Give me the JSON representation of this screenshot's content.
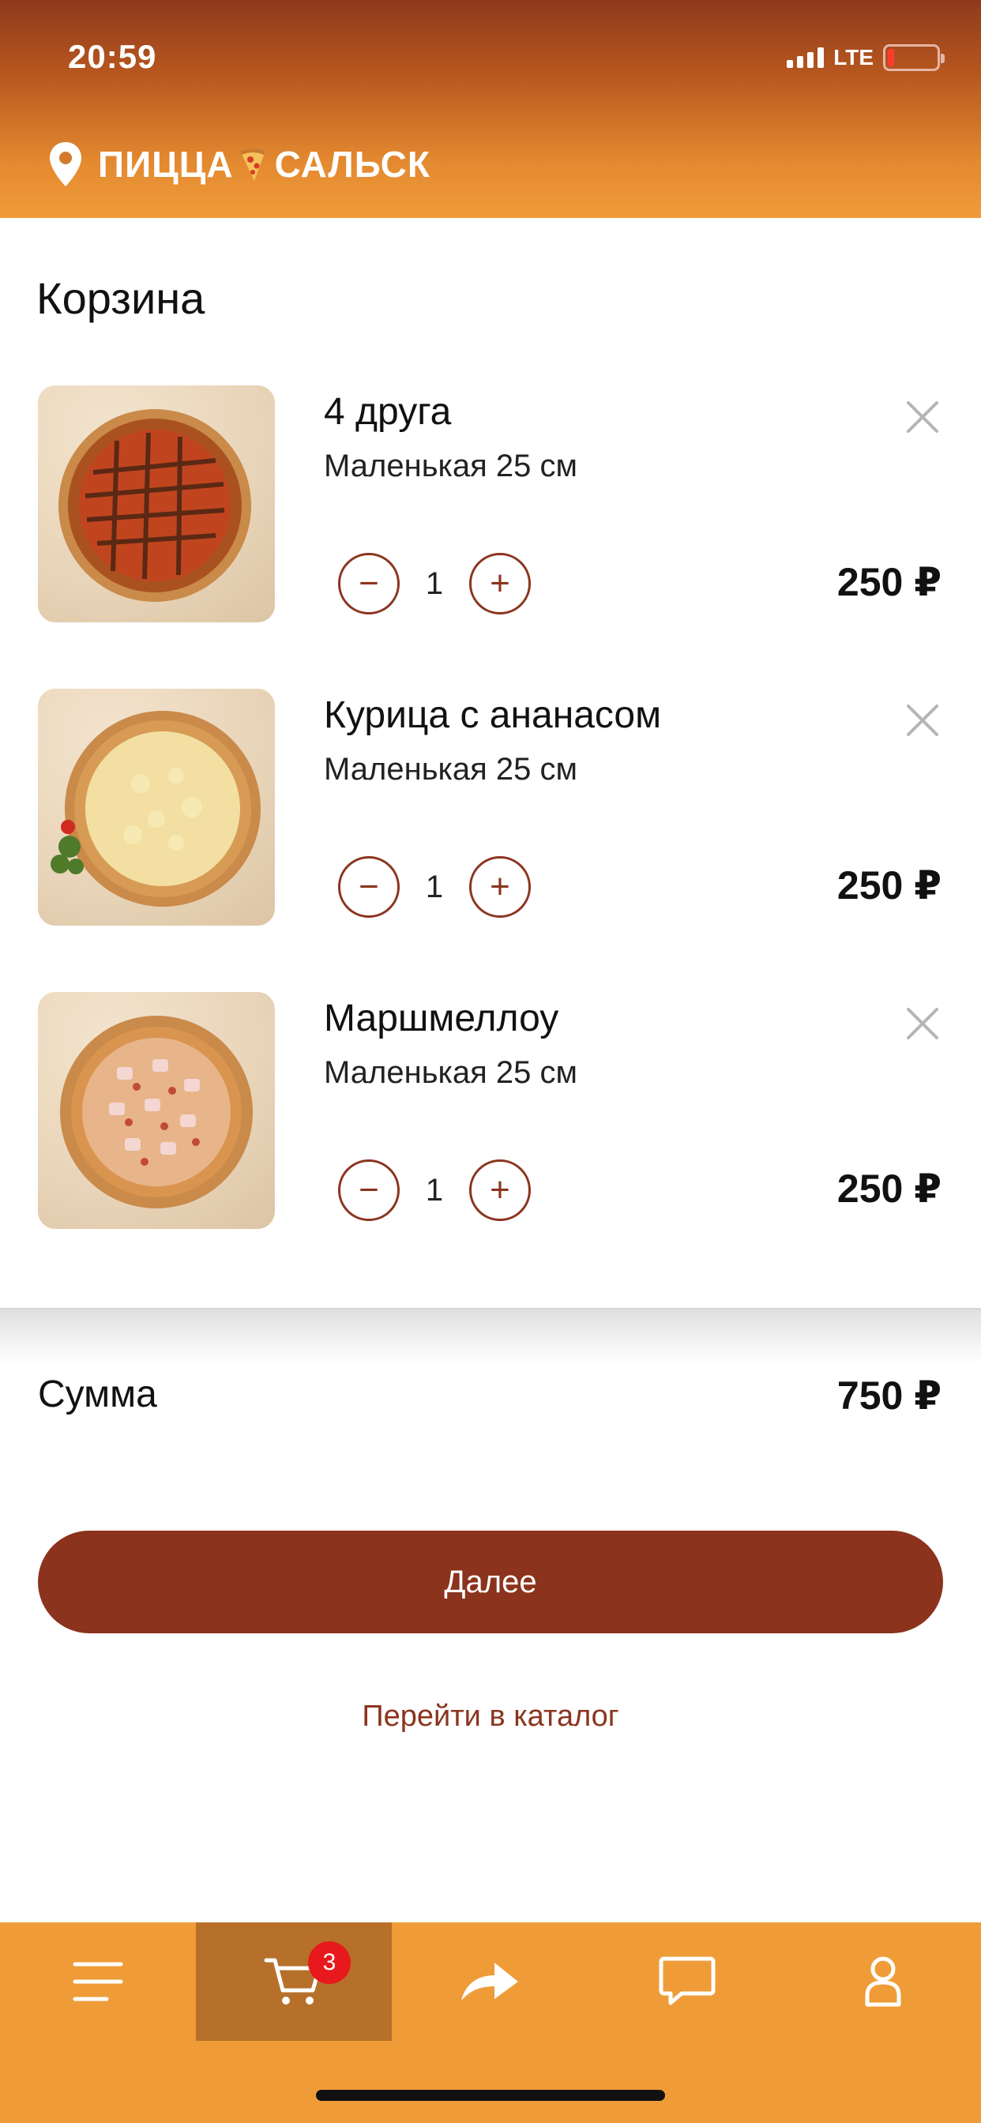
{
  "status": {
    "time": "20:59",
    "network": "LTE"
  },
  "header": {
    "brand_part1": "ПИЦЦА",
    "brand_part2": "САЛЬСК",
    "icon": "location-pin-icon"
  },
  "page": {
    "title": "Корзина"
  },
  "cart": {
    "items": [
      {
        "name": "4 друга",
        "size": "Маленькая 25 см",
        "quantity": "1",
        "price": "250 ₽"
      },
      {
        "name": "Курица с ананасом",
        "size": "Маленькая 25 см",
        "quantity": "1",
        "price": "250 ₽"
      },
      {
        "name": "Маршмеллоу",
        "size": "Маленькая 25 см",
        "quantity": "1",
        "price": "250 ₽"
      }
    ],
    "minus_symbol": "−",
    "plus_symbol": "+"
  },
  "summary": {
    "label": "Сумма",
    "total": "750 ₽"
  },
  "actions": {
    "next_label": "Далее",
    "catalog_link": "Перейти в каталог"
  },
  "tabbar": {
    "cart_badge": "3",
    "tabs": [
      "menu-icon",
      "cart-icon",
      "share-icon",
      "chat-icon",
      "profile-icon"
    ]
  },
  "colors": {
    "accent": "#8b331d",
    "tabbar": "#ef9c38",
    "tab_active": "#b7702a",
    "badge": "#e8191d"
  }
}
